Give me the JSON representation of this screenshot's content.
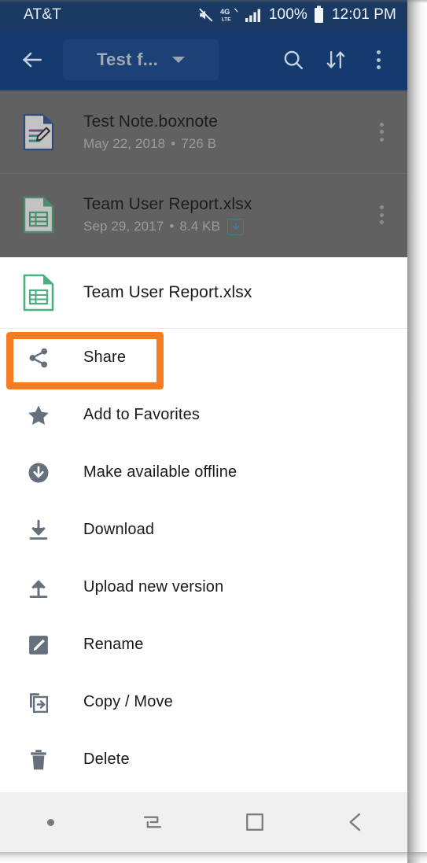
{
  "status_bar": {
    "carrier": "AT&T",
    "mute_icon": "mute-icon",
    "network_label": "4G LTE",
    "signal_icon": "signal-bars-icon",
    "battery_percent": "100%",
    "battery_icon": "battery-full-icon",
    "clock": "12:01 PM"
  },
  "app_bar": {
    "background_color": "#153a6e",
    "back_icon": "back-arrow-icon",
    "title": "Test f...",
    "dropdown_icon": "chevron-down-icon",
    "search_icon": "search-icon",
    "sort_icon": "sort-icon",
    "overflow_icon": "overflow-menu-icon"
  },
  "file_list": [
    {
      "icon": "boxnote-file-icon",
      "name": "Test Note.boxnote",
      "date": "May 22, 2018",
      "separator": "•",
      "size": "726 B",
      "has_download_badge": false,
      "overflow_icon": "overflow-menu-icon"
    },
    {
      "icon": "spreadsheet-file-icon",
      "name": "Team User Report.xlsx",
      "date": "Sep 29, 2017",
      "separator": "•",
      "size": "8.4 KB",
      "has_download_badge": true,
      "download_badge_icon": "download-badge-icon",
      "overflow_icon": "overflow-menu-icon"
    }
  ],
  "sheet": {
    "header": {
      "icon": "spreadsheet-file-icon",
      "file_name": "Team User Report.xlsx"
    },
    "items": [
      {
        "icon": "share-icon",
        "label": "Share",
        "highlighted": true
      },
      {
        "icon": "star-icon",
        "label": "Add to Favorites",
        "highlighted": false
      },
      {
        "icon": "offline-circle-download-icon",
        "label": "Make available offline",
        "highlighted": false
      },
      {
        "icon": "download-icon",
        "label": "Download",
        "highlighted": false
      },
      {
        "icon": "upload-icon",
        "label": "Upload new version",
        "highlighted": false
      },
      {
        "icon": "rename-pencil-icon",
        "label": "Rename",
        "highlighted": false
      },
      {
        "icon": "copy-move-icon",
        "label": "Copy / Move",
        "highlighted": false
      },
      {
        "icon": "trash-icon",
        "label": "Delete",
        "highlighted": false
      }
    ]
  },
  "annotation": {
    "highlight_color": "#F57C20",
    "target_label": "Share"
  },
  "nav_bar": {
    "items": [
      {
        "icon": "nav-dot-icon"
      },
      {
        "icon": "recents-icon"
      },
      {
        "icon": "home-icon"
      },
      {
        "icon": "back-icon"
      }
    ]
  }
}
